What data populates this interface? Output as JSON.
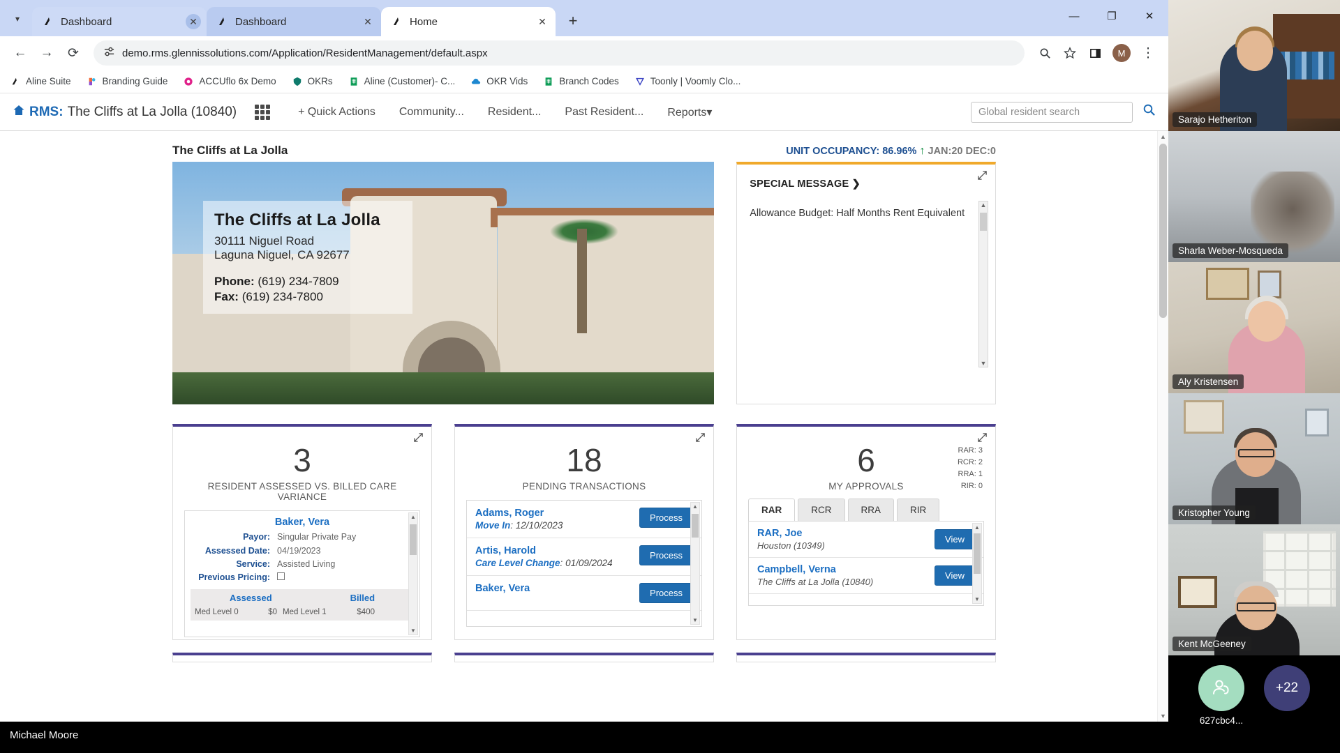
{
  "browser": {
    "tab_search_icon": "chevron-down-icon",
    "tabs": [
      {
        "title": "Dashboard",
        "favicon": "aline-icon",
        "state": "inactive-hovered"
      },
      {
        "title": "Dashboard",
        "favicon": "aline-icon",
        "state": "inactive"
      },
      {
        "title": "Home",
        "favicon": "aline-icon",
        "state": "active"
      }
    ],
    "new_tab_label": "+",
    "window_controls": {
      "minimize": "—",
      "maximize": "❐",
      "close": "✕"
    },
    "nav": {
      "back": "←",
      "forward": "→",
      "reload": "⟳"
    },
    "omnibox": {
      "site_info_icon": "page-settings-icon",
      "url": "demo.rms.glennissolutions.com/Application/ResidentManagement/default.aspx"
    },
    "toolbar_icons": {
      "zoom": "magnifier-icon",
      "bookmark": "star-icon",
      "side_panel": "side-panel-icon",
      "profile_initial": "M",
      "menu": "⋮"
    },
    "bookmarks": [
      {
        "label": "Aline Suite",
        "icon": "aline-icon"
      },
      {
        "label": "Branding Guide",
        "icon": "brandfolder-icon"
      },
      {
        "label": "ACCUflo 6x Demo",
        "icon": "accuflo-icon"
      },
      {
        "label": "OKRs",
        "icon": "shield-icon"
      },
      {
        "label": "Aline (Customer)- C...",
        "icon": "sheets-icon"
      },
      {
        "label": "OKR Vids",
        "icon": "cloud-icon"
      },
      {
        "label": "Branch Codes",
        "icon": "sheets-icon"
      },
      {
        "label": "Toonly | Voomly Clo...",
        "icon": "toonly-icon"
      }
    ]
  },
  "app": {
    "brand_prefix": "RMS:",
    "brand_property": "The Cliffs at La Jolla (10840)",
    "home_icon": "home-icon",
    "grid_icon": "app-grid-icon",
    "nav_items": [
      {
        "label": "+ Quick Actions"
      },
      {
        "label": "Community..."
      },
      {
        "label": "Resident..."
      },
      {
        "label": "Past Resident..."
      },
      {
        "label": "Reports"
      }
    ],
    "reports_caret": "▾",
    "search_placeholder": "Global resident search",
    "search_icon": "search-icon"
  },
  "dashboard": {
    "property_name": "The Cliffs at La Jolla",
    "occupancy_label": "UNIT OCCUPANCY: 86.96%",
    "occupancy_arrow": "↑",
    "occupancy_months": "JAN:20 DEC:0",
    "hero": {
      "title": "The Cliffs at La Jolla",
      "address_line1": "30111 Niguel Road",
      "address_line2": "Laguna Niguel, CA 92677",
      "phone_label": "Phone:",
      "phone": "(619) 234-7809",
      "fax_label": "Fax:",
      "fax": "(619) 234-7800"
    },
    "special_message": {
      "title": "SPECIAL MESSAGE",
      "chevron": "❯",
      "body": "Allowance Budget: Half Months Rent Equivalent",
      "expand_icon": "expand-icon"
    },
    "variance_card": {
      "count": "3",
      "caption": "RESIDENT ASSESSED VS. BILLED CARE VARIANCE",
      "expand_icon": "expand-icon",
      "resident": "Baker, Vera",
      "fields": [
        {
          "label": "Payor:",
          "value": "Singular Private Pay"
        },
        {
          "label": "Assessed Date:",
          "value": "04/19/2023"
        },
        {
          "label": "Service:",
          "value": "Assisted Living"
        },
        {
          "label": "Previous Pricing:",
          "value": ""
        }
      ],
      "table_headers": [
        "Assessed",
        "Billed"
      ],
      "table_row": {
        "assessed_item": "Med Level 0",
        "assessed_amount": "$0",
        "billed_item": "Med Level 1",
        "billed_amount": "$400"
      }
    },
    "pending_card": {
      "count": "18",
      "caption": "PENDING TRANSACTIONS",
      "expand_icon": "expand-icon",
      "action_label": "Process",
      "rows": [
        {
          "name": "Adams, Roger",
          "type": "Move In",
          "date": "12/10/2023"
        },
        {
          "name": "Artis, Harold",
          "type": "Care Level Change",
          "date": "01/09/2024"
        },
        {
          "name": "Baker, Vera",
          "type": "",
          "date": ""
        }
      ]
    },
    "approvals_card": {
      "count": "6",
      "caption": "MY APPROVALS",
      "expand_icon": "expand-icon",
      "breakdown": [
        "RAR: 3",
        "RCR: 2",
        "RRA: 1",
        "RIR: 0"
      ],
      "tabs": [
        "RAR",
        "RCR",
        "RRA",
        "RIR"
      ],
      "selected_tab": "RAR",
      "action_label": "View",
      "rows": [
        {
          "name": "RAR, Joe",
          "community": "Houston (10349)"
        },
        {
          "name": "Campbell, Verna",
          "community": "The Cliffs at La Jolla (10840)"
        }
      ]
    }
  },
  "meeting": {
    "participants": [
      {
        "name": "Sarajo Hetheriton"
      },
      {
        "name": "Sharla Weber-Mosqueda"
      },
      {
        "name": "Aly Kristensen"
      },
      {
        "name": "Kristopher Young"
      },
      {
        "name": "Kent McGeeney"
      }
    ],
    "audio_participant": {
      "label": "627cbc4...",
      "icon": "phone-person-icon"
    },
    "overflow_badge": "+22"
  },
  "taskbar": {
    "user": "Michael Moore"
  },
  "colors": {
    "chrome_tabstrip": "#c9d7f5",
    "app_blue": "#1d69b4",
    "card_accent_purple": "#4a3f8f",
    "card_accent_orange": "#f0a92b",
    "button_blue": "#1f6cb0",
    "occupancy_blue": "#1d4f91",
    "up_arrow_green": "#0a8a3c"
  }
}
